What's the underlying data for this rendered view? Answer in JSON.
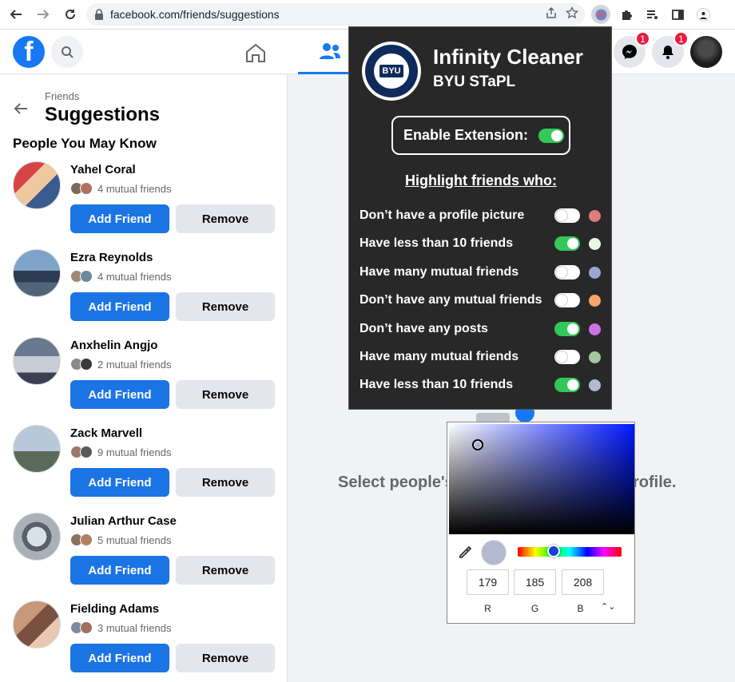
{
  "browser": {
    "url": "facebook.com/friends/suggestions"
  },
  "header": {
    "logo_letter": "f",
    "messenger_badge": "1",
    "notifications_badge": "1"
  },
  "sidebar": {
    "breadcrumb": "Friends",
    "title": "Suggestions",
    "section_title": "People You May Know",
    "add_label": "Add Friend",
    "remove_label": "Remove",
    "suggestions": [
      {
        "name": "Yahel Coral",
        "mutual": "4 mutual friends"
      },
      {
        "name": "Ezra Reynolds",
        "mutual": "4 mutual friends"
      },
      {
        "name": "Anxhelin Angjo",
        "mutual": "2 mutual friends"
      },
      {
        "name": "Zack Marvell",
        "mutual": "9 mutual friends"
      },
      {
        "name": "Julian Arthur Case",
        "mutual": "5 mutual friends"
      },
      {
        "name": "Fielding Adams",
        "mutual": "3 mutual friends"
      }
    ]
  },
  "main": {
    "message_left": "Select people's",
    "message_right": "rofile."
  },
  "popup": {
    "title": "Infinity Cleaner",
    "subtitle": "BYU STaPL",
    "seal_text": "BYU",
    "enable_label": "Enable Extension:",
    "enable_on": true,
    "highlight_heading": "Highlight friends who:",
    "rules": [
      {
        "label": "Don’t have a profile picture",
        "on": false,
        "color": "#e07b80"
      },
      {
        "label": "Have less than 10 friends",
        "on": true,
        "color": "#e8f7e4"
      },
      {
        "label": "Have many mutual friends",
        "on": false,
        "color": "#9aa6d6"
      },
      {
        "label": "Don’t have any mutual friends",
        "on": false,
        "color": "#f5a46a"
      },
      {
        "label": "Don’t have any posts",
        "on": true,
        "color": "#cc73e6"
      },
      {
        "label": "Have many mutual friends",
        "on": false,
        "color": "#a3c8a0"
      },
      {
        "label": "Have less than 10 friends",
        "on": true,
        "color": "#b3b9d0"
      }
    ]
  },
  "color_picker": {
    "preview_color": "#b3b9d0",
    "r": "179",
    "g": "185",
    "b": "208",
    "r_label": "R",
    "g_label": "G",
    "b_label": "B",
    "mode_glyph": "⌃⌄"
  }
}
